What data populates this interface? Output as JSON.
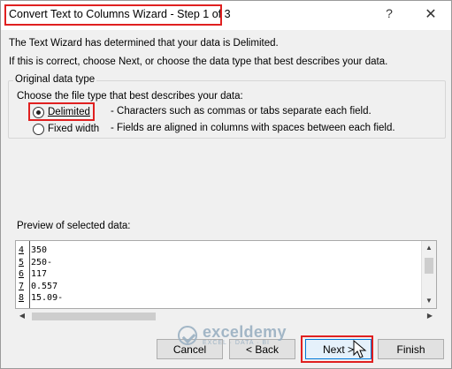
{
  "window": {
    "title": "Convert Text to Columns Wizard - Step 1 of 3",
    "help_glyph": "?",
    "close_glyph": "✕"
  },
  "intro": {
    "line1": "The Text Wizard has determined that your data is Delimited.",
    "line2": "If this is correct, choose Next, or choose the data type that best describes your data."
  },
  "original_data_type": {
    "legend": "Original data type",
    "prompt": "Choose the file type that best describes your data:",
    "options": [
      {
        "label": "Delimited",
        "description": "- Characters such as commas or tabs separate each field.",
        "selected": true
      },
      {
        "label": "Fixed width",
        "description": "- Fields are aligned in columns with spaces between each field.",
        "selected": false
      }
    ]
  },
  "preview": {
    "label": "Preview of selected data:",
    "rows": [
      {
        "num": "4",
        "value": "350"
      },
      {
        "num": "5",
        "value": "250-"
      },
      {
        "num": "6",
        "value": "117"
      },
      {
        "num": "7",
        "value": "0.557"
      },
      {
        "num": "8",
        "value": "15.09-"
      }
    ]
  },
  "buttons": {
    "cancel": "Cancel",
    "back": "< Back",
    "next": "Next >",
    "finish": "Finish"
  },
  "watermark": {
    "name": "exceldemy",
    "tagline": "EXCEL · DATA · BI"
  },
  "colors": {
    "highlight_red": "#e02020",
    "dialog_bg": "#f0f0f0",
    "primary_button_border": "#0078d7"
  },
  "icons": {
    "up": "▲",
    "down": "▼",
    "left": "◀",
    "right": "▶"
  }
}
